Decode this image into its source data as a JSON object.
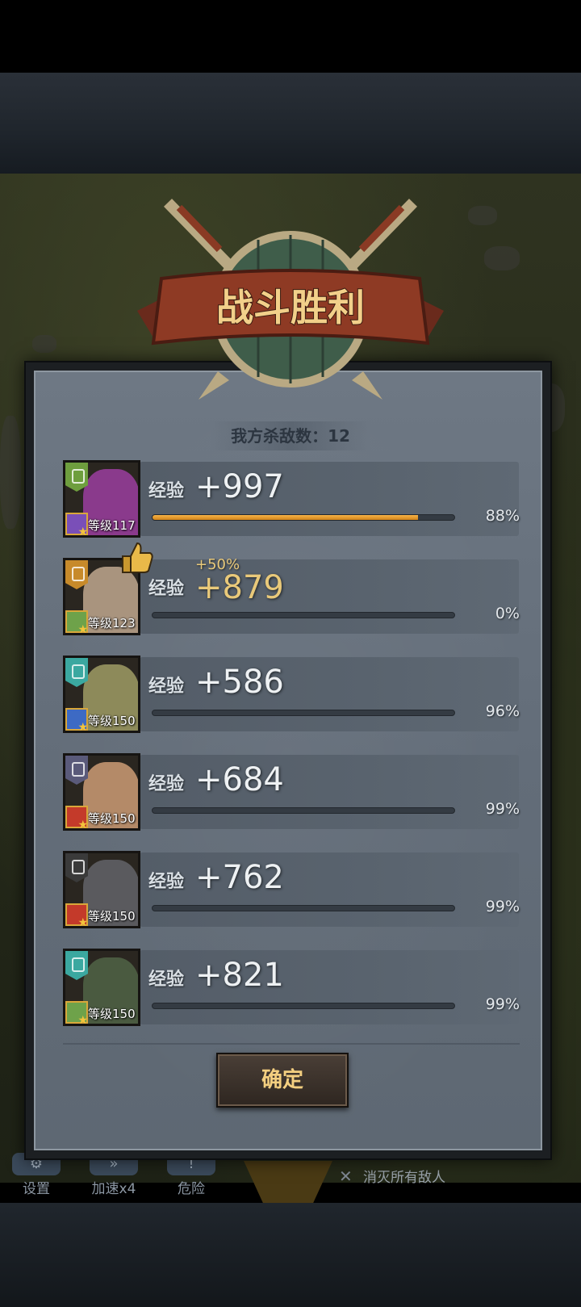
{
  "result_title": "战斗胜利",
  "kill_count_text": "我方杀敌数：12",
  "exp_label": "经验",
  "heroes": [
    {
      "level": "等级117",
      "exp": "+997",
      "pct": "88%",
      "progress": 0.88,
      "bonus": "",
      "class_color": "#6e9e3e",
      "role_color": "#7a4fb8",
      "face_color": "#8a3a8c"
    },
    {
      "level": "等级123",
      "exp": "+879",
      "pct": "0%",
      "progress": 0.0,
      "bonus": "+50%",
      "class_color": "#c78a2a",
      "role_color": "#6ea24a",
      "face_color": "#a9947e"
    },
    {
      "level": "等级150",
      "exp": "+586",
      "pct": "96%",
      "progress": 0.0,
      "bonus": "",
      "class_color": "#3ba8a0",
      "role_color": "#3d6ac4",
      "face_color": "#8d8a5a"
    },
    {
      "level": "等级150",
      "exp": "+684",
      "pct": "99%",
      "progress": 0.0,
      "bonus": "",
      "class_color": "#5a5a7a",
      "role_color": "#c43a2a",
      "face_color": "#b48a68"
    },
    {
      "level": "等级150",
      "exp": "+762",
      "pct": "99%",
      "progress": 0.0,
      "bonus": "",
      "class_color": "#3a3a3a",
      "role_color": "#c43a2a",
      "face_color": "#5a5a5e"
    },
    {
      "level": "等级150",
      "exp": "+821",
      "pct": "99%",
      "progress": 0.0,
      "bonus": "",
      "class_color": "#3ba8a0",
      "role_color": "#6ea24a",
      "face_color": "#4a5a40"
    }
  ],
  "confirm_label": "确定",
  "hud": {
    "settings": "设置",
    "speed": "加速x4",
    "danger": "危险",
    "goal": "消灭所有敌人"
  }
}
